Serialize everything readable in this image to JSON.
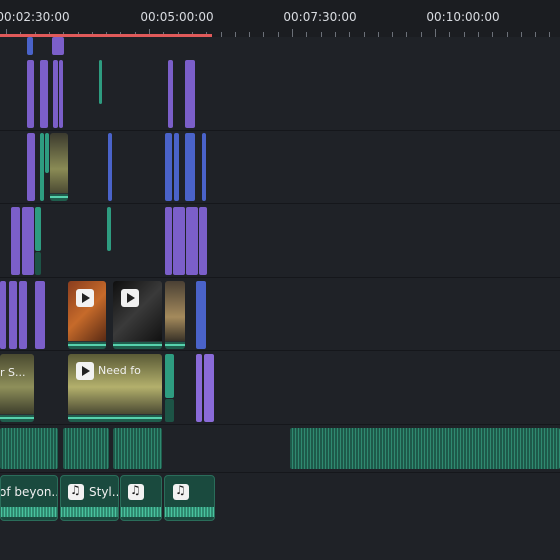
{
  "ruler": {
    "timecodes": [
      "00:02:30:00",
      "00:05:00:00",
      "00:07:30:00",
      "00:10:00:00"
    ]
  },
  "video_clips": {
    "thumb_a_title": "",
    "thumb_main_label": "r S...",
    "thumb_main2_label": "Need fo"
  },
  "audio_clips": {
    "clip1_label": "of beyon...",
    "clip2_label": "Styl...",
    "clip3_label": "",
    "clip4_label": ""
  },
  "colors": {
    "playhead_progress": "#e05a5a",
    "video_clip": "#7b5fc9",
    "audio_clip": "#2e9c80",
    "overlay_clip": "#4a63c9"
  }
}
